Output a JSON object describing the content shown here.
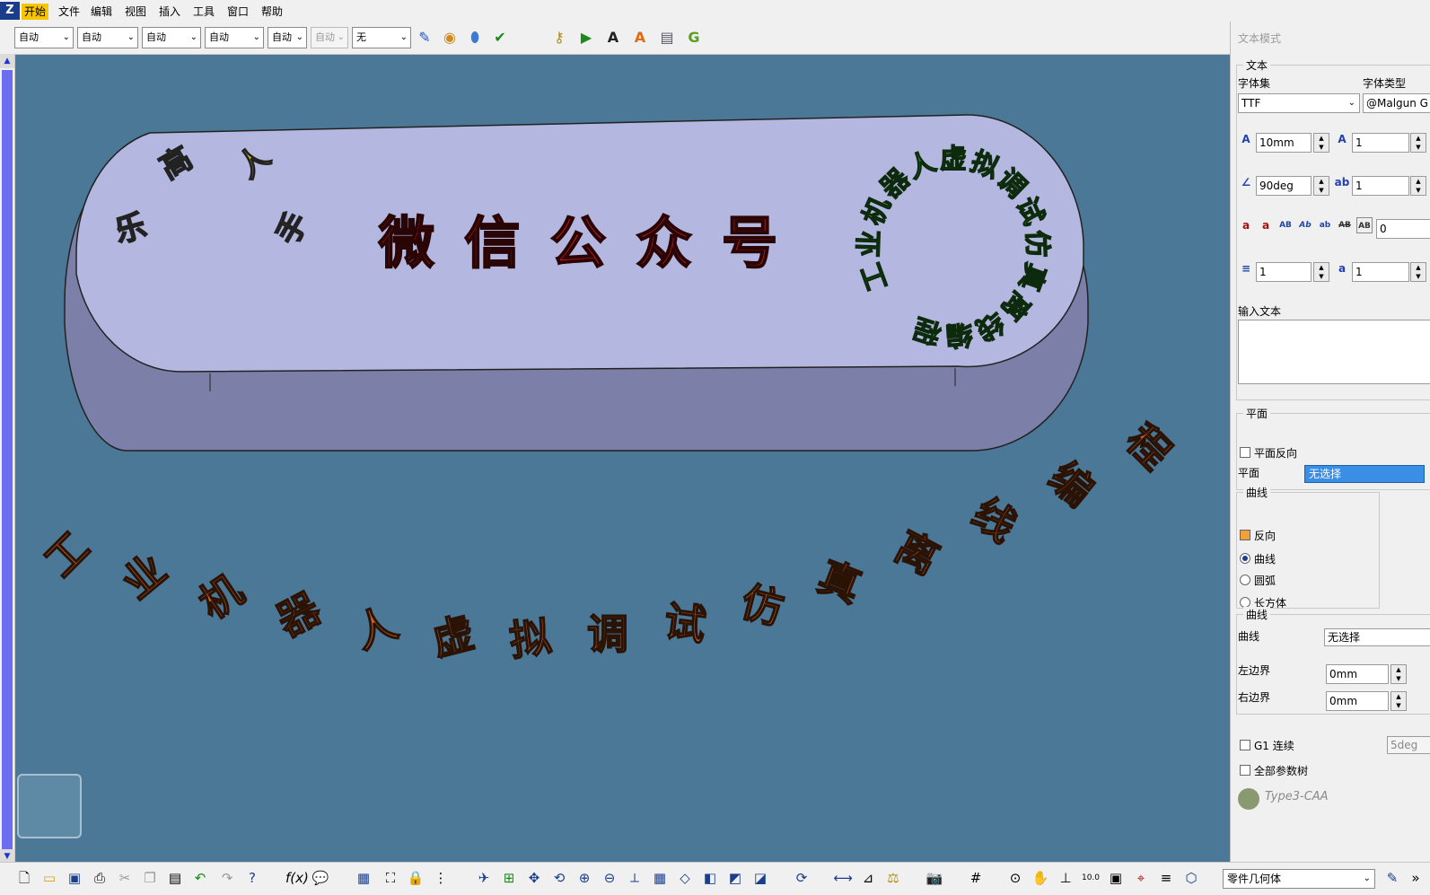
{
  "app": {
    "logo": "Z"
  },
  "menu": [
    {
      "label": "开始",
      "active": true
    },
    {
      "label": "文件"
    },
    {
      "label": "编辑"
    },
    {
      "label": "视图"
    },
    {
      "label": "插入"
    },
    {
      "label": "工具"
    },
    {
      "label": "窗口"
    },
    {
      "label": "帮助"
    }
  ],
  "toolbar": {
    "combos": [
      "自动",
      "自动",
      "自动",
      "自动",
      "自动",
      "自动",
      "无"
    ],
    "icons": [
      "paint-brush-icon",
      "material-icon",
      "eraser-icon",
      "check-icon",
      "key-icon",
      "select-g-icon",
      "text-a-icon",
      "aa-text-icon",
      "toolbox-icon",
      "g-logo-icon"
    ]
  },
  "viewport": {
    "plate_text": "微 信 公 众 号",
    "left_chars": [
      "乐",
      "高",
      "人",
      "手"
    ],
    "circle_text": "工业机器人虚拟调试仿真离线编程",
    "arc_text": "工业机器人虚拟调试仿真离线编程"
  },
  "panel": {
    "title": "文本模式",
    "text_group": "文本",
    "font_set_label": "字体集",
    "font_type_label": "字体类型",
    "font_set_value": "TTF",
    "font_type_value": "@Malgun G",
    "height_value": "10mm",
    "ratio_value": "1",
    "angle_value": "90deg",
    "spacing_value": "1",
    "style_value": "0",
    "sub_value1": "1",
    "sub_value2": "1",
    "input_text_label": "输入文本",
    "input_text_value": "",
    "plane_group": "平面",
    "plane_reverse_label": "平面反向",
    "plane_label": "平面",
    "plane_value": "无选择",
    "curve_group": "曲线",
    "reverse_label": "反向",
    "curve_option": "曲线",
    "arc_option": "圆弧",
    "box_option": "长方体",
    "curve_group2": "曲线",
    "curve_label": "曲线",
    "curve_value": "无选择",
    "left_bound_label": "左边界",
    "left_bound_value": "0mm",
    "right_bound_label": "右边界",
    "right_bound_value": "0mm",
    "g1_label": "G1 连续",
    "g1_value": "5deg",
    "all_params_label": "全部参数树",
    "brand": "Type3-CAA"
  },
  "statusbar": {
    "mode": "零件几何体"
  },
  "colors": {
    "viewport_bg": "#4a7896",
    "plate": "#b4b8e0",
    "red_text": "#b01818",
    "green_text": "#2a7a2a",
    "orange_text": "#c0602a",
    "accent": "#f7c600"
  }
}
